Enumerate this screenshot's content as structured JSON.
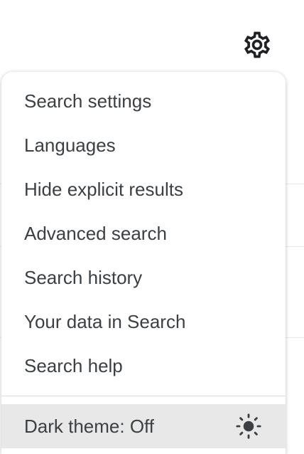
{
  "header": {
    "settings_icon": "gear-icon"
  },
  "menu": {
    "items": [
      {
        "label": "Search settings"
      },
      {
        "label": "Languages"
      },
      {
        "label": "Hide explicit results"
      },
      {
        "label": "Advanced search"
      },
      {
        "label": "Search history"
      },
      {
        "label": "Your data in Search"
      },
      {
        "label": "Search help"
      }
    ],
    "dark_theme": {
      "label": "Dark theme: Off",
      "icon": "sun-icon"
    }
  },
  "colors": {
    "text": "#3c4043",
    "icon": "#202124",
    "highlight": "#e8e8e8",
    "divider": "#dadce0"
  }
}
